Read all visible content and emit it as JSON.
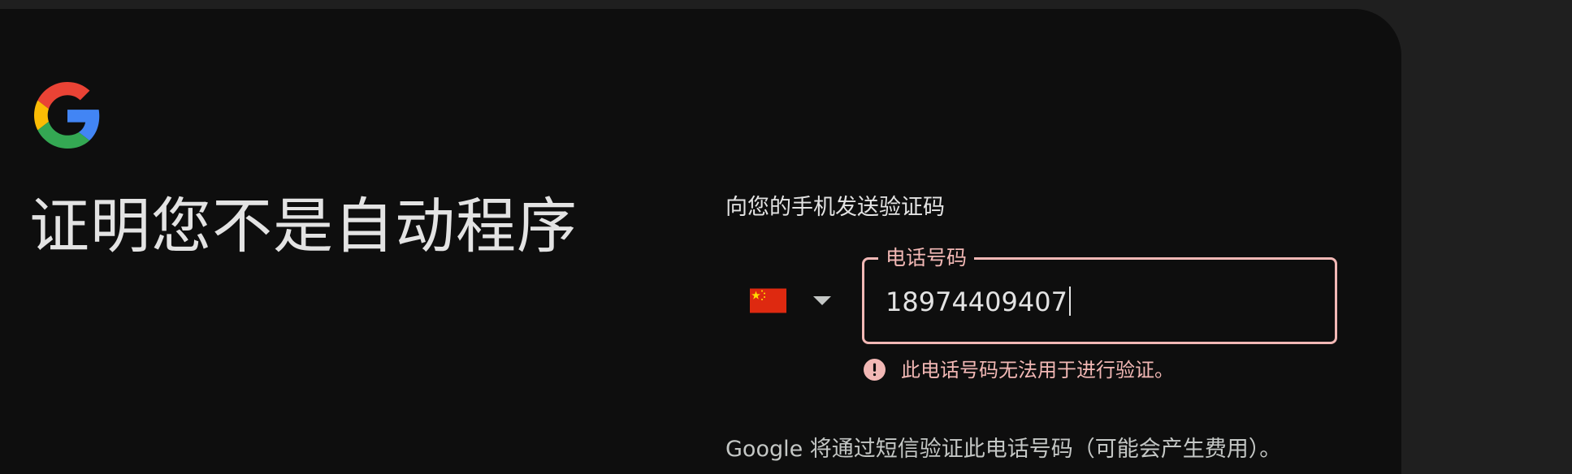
{
  "page": {
    "headline": "证明您不是自动程序"
  },
  "logo": {
    "icon": "google-g-icon",
    "colors": {
      "blue": "#4285F4",
      "red": "#EA4335",
      "yellow": "#FBBC05",
      "green": "#34A853"
    }
  },
  "form": {
    "send_label": "向您的手机发送验证码",
    "country": {
      "icon": "china-flag-icon",
      "dropdown_icon": "arrow-drop-down-icon"
    },
    "phone_field": {
      "label": "电话号码",
      "value": "18974409407"
    },
    "error": {
      "icon": "error-icon",
      "text": "此电话号码无法用于进行验证。"
    },
    "info": "Google 将通过短信验证此电话号码（可能会产生费用）。"
  },
  "colors": {
    "background": "#0e0e0e",
    "outer": "#1f1f1f",
    "text": "#e3e3e3",
    "error": "#f2b8b5"
  }
}
